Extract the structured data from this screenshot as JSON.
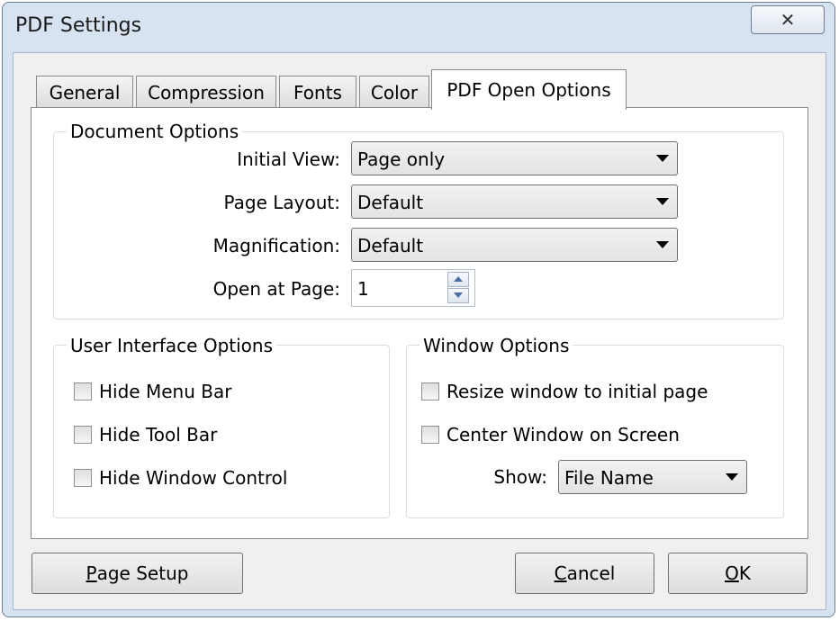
{
  "window": {
    "title": "PDF Settings",
    "close_glyph": "✕"
  },
  "tabs": [
    {
      "label": "General",
      "active": false
    },
    {
      "label": "Compression",
      "active": false
    },
    {
      "label": "Fonts",
      "active": false
    },
    {
      "label": "Color",
      "active": false
    },
    {
      "label": "PDF Open Options",
      "active": true
    }
  ],
  "document_options": {
    "title": "Document Options",
    "initial_view": {
      "label": "Initial View:",
      "value": "Page only"
    },
    "page_layout": {
      "label": "Page Layout:",
      "value": "Default"
    },
    "magnification": {
      "label": "Magnification:",
      "value": "Default"
    },
    "open_at_page": {
      "label": "Open at Page:",
      "value": "1"
    }
  },
  "ui_options": {
    "title": "User Interface Options",
    "hide_menu_bar": {
      "label": "Hide Menu Bar",
      "checked": false
    },
    "hide_tool_bar": {
      "label": "Hide Tool Bar",
      "checked": false
    },
    "hide_window_control": {
      "label": "Hide Window Control",
      "checked": false
    }
  },
  "window_options": {
    "title": "Window Options",
    "resize_window": {
      "label": "Resize window to initial page",
      "checked": false
    },
    "center_window": {
      "label": "Center Window on Screen",
      "checked": false
    },
    "show": {
      "label": "Show:",
      "value": "File Name"
    }
  },
  "buttons": {
    "page_setup": {
      "mnemonic": "P",
      "rest": "age Setup"
    },
    "cancel": {
      "mnemonic": "C",
      "rest": "ancel"
    },
    "ok": {
      "mnemonic": "O",
      "rest": "K"
    }
  }
}
